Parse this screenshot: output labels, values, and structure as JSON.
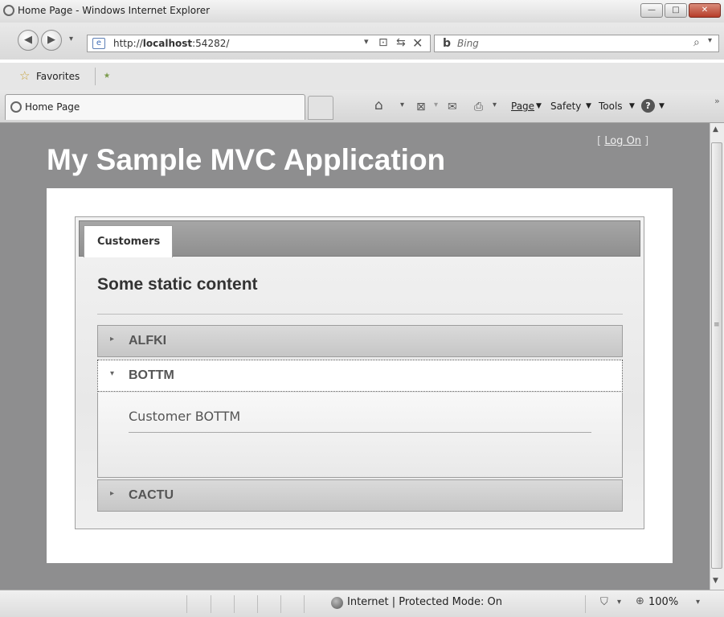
{
  "window": {
    "title": "Home Page - Windows Internet Explorer",
    "minimize_glyph": "—",
    "maximize_glyph": "□",
    "close_glyph": "✕"
  },
  "address_bar": {
    "url_prefix": "http://",
    "url_host": "localhost",
    "url_rest": ":54282/",
    "search_placeholder": "Bing"
  },
  "favorites_bar": {
    "favorites_label": "Favorites"
  },
  "tab": {
    "label": "Home Page"
  },
  "command_bar": {
    "page_label": "Page",
    "safety_label": "Safety",
    "tools_label": "Tools"
  },
  "app": {
    "title": "My Sample MVC Application",
    "logon_open": "[ ",
    "logon_link": "Log On",
    "logon_close": " ]",
    "tabs": [
      {
        "label": "Customers"
      }
    ],
    "static_heading": "Some static content",
    "panels": [
      {
        "label": "ALFKI",
        "expanded": false
      },
      {
        "label": "BOTTM",
        "expanded": true,
        "content": "Customer BOTTM"
      },
      {
        "label": "CACTU",
        "expanded": false
      }
    ]
  },
  "status_bar": {
    "zone_text": "Internet | Protected Mode: On",
    "zoom_text": "100%"
  },
  "icons": {
    "collapsed_arrow": "▸",
    "expanded_arrow": "▾"
  }
}
